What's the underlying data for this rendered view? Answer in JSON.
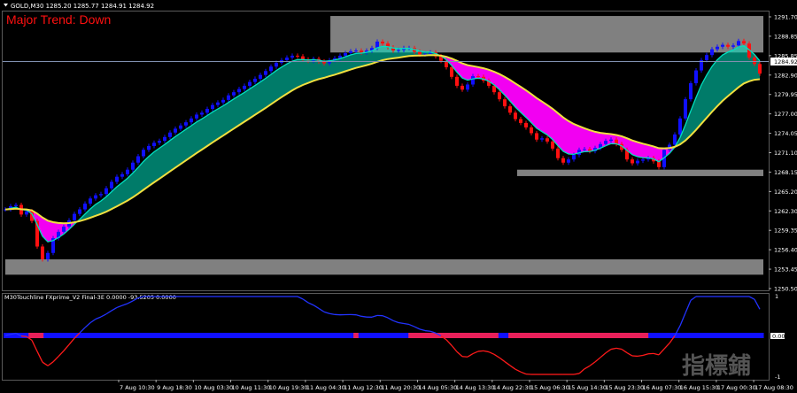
{
  "header": {
    "symbol_info": "GOLD,M30  1285.20 1285.77 1284.91 1284.92",
    "trend_label": "Major Trend: Down"
  },
  "indicator": {
    "label": "M30Touchline  FXprime_V2 Final-3E 0.0000 -93.5205 0.0000",
    "scale_top": "1",
    "scale_mid": "0.00",
    "scale_bottom": "-1"
  },
  "watermark": "指標鋪",
  "colors": {
    "background": "#000000",
    "bull_candle": "#1010ff",
    "bear_candle": "#ff1010",
    "fast_band": "#00e0c0",
    "ribbon_down": "#ff00ff",
    "slow_ma": "#f0e040",
    "zone_box": "#808080",
    "osc_line_up": "#2233ff",
    "osc_line_down": "#ff1a1a",
    "grid": "#5a5a5a"
  },
  "price_axis": {
    "current_price": "1284.92",
    "ticks": [
      "1291.70",
      "1288.85",
      "1285.85",
      "1282.90",
      "1279.95",
      "1277.00",
      "1274.05",
      "1271.10",
      "1268.15",
      "1265.20",
      "1262.30",
      "1259.35",
      "1256.40",
      "1253.45",
      "1250.50"
    ]
  },
  "time_axis": {
    "ticks": [
      "7 Aug 10:30",
      "9 Aug 18:30",
      "10 Aug 03:30",
      "10 Aug 11:30",
      "10 Aug 19:30",
      "11 Aug 04:30",
      "11 Aug 12:30",
      "11 Aug 20:30",
      "14 Aug 05:30",
      "14 Aug 13:30",
      "14 Aug 22:30",
      "15 Aug 06:30",
      "15 Aug 14:30",
      "15 Aug 23:30",
      "16 Aug 07:30",
      "16 Aug 15:30",
      "17 Aug 00:30",
      "17 Aug 08:30"
    ]
  },
  "chart_data": {
    "type": "candlestick",
    "symbol": "GOLD",
    "timeframe": "M30",
    "price_range": [
      1249.8,
      1293.2
    ],
    "close": [
      1262.3,
      1262.8,
      1263.0,
      1261.5,
      1262.0,
      1260.5,
      1256.5,
      1254.5,
      1255.5,
      1257.8,
      1258.8,
      1259.6,
      1260.6,
      1261.6,
      1262.3,
      1263.2,
      1264.0,
      1264.5,
      1264.7,
      1265.6,
      1266.6,
      1267.4,
      1267.8,
      1268.5,
      1269.6,
      1270.6,
      1271.6,
      1272.2,
      1272.7,
      1273.0,
      1273.6,
      1274.3,
      1274.9,
      1275.4,
      1275.9,
      1276.5,
      1277.1,
      1277.4,
      1278.0,
      1278.6,
      1279.0,
      1279.4,
      1280.1,
      1280.6,
      1281.1,
      1281.6,
      1282.2,
      1282.7,
      1283.3,
      1283.9,
      1284.6,
      1285.2,
      1285.6,
      1286.0,
      1286.3,
      1286.2,
      1285.7,
      1285.5,
      1285.8,
      1285.4,
      1285.1,
      1285.6,
      1285.9,
      1286.3,
      1286.7,
      1287.0,
      1287.1,
      1286.8,
      1287.1,
      1287.5,
      1288.5,
      1288.2,
      1287.6,
      1287.1,
      1287.2,
      1287.5,
      1287.5,
      1286.9,
      1286.5,
      1286.6,
      1286.8,
      1286.2,
      1285.5,
      1284.5,
      1283.0,
      1281.6,
      1281.0,
      1281.8,
      1283.1,
      1283.0,
      1282.4,
      1281.6,
      1280.6,
      1279.5,
      1278.4,
      1277.4,
      1276.4,
      1275.8,
      1275.1,
      1274.2,
      1273.2,
      1273.4,
      1272.9,
      1271.8,
      1270.3,
      1269.6,
      1270.1,
      1270.8,
      1271.6,
      1271.7,
      1271.4,
      1271.9,
      1272.5,
      1273.0,
      1273.2,
      1272.5,
      1271.6,
      1270.1,
      1269.5,
      1269.9,
      1270.1,
      1270.3,
      1269.8,
      1268.9,
      1271.6,
      1272.4,
      1274.0,
      1276.5,
      1279.5,
      1282.0,
      1284.0,
      1285.6,
      1286.4,
      1287.3,
      1287.7,
      1288.0,
      1287.7,
      1287.9,
      1288.6,
      1288.2,
      1286.0,
      1285.0,
      1283.5
    ],
    "zones": [
      {
        "from": 1286.8,
        "to": 1292.5,
        "start": "11 Aug 12:30",
        "end": "17 Aug 08:30"
      },
      {
        "from": 1252.1,
        "to": 1254.5,
        "start": "7 Aug 10:30",
        "end": "17 Aug 08:30"
      },
      {
        "from": 1267.5,
        "to": 1268.5,
        "start": "15 Aug 06:30",
        "end": "17 Aug 08:30"
      }
    ],
    "slow_ma_type": "line",
    "oscillator": {
      "name": "M30Touchline FXprime_V2 Final-3E",
      "values_shown": [
        0.0,
        -93.5205,
        0.0
      ],
      "range": [
        -1,
        1
      ],
      "histogram": [
        "blue",
        "blue",
        "blue",
        "blue",
        "blue",
        "red",
        "red",
        "red",
        "blue",
        "blue",
        "blue",
        "blue",
        "blue",
        "blue",
        "blue",
        "blue",
        "blue",
        "blue",
        "blue",
        "blue",
        "blue",
        "blue",
        "blue",
        "blue",
        "blue",
        "blue",
        "blue",
        "blue",
        "blue",
        "blue",
        "blue",
        "blue",
        "blue",
        "blue",
        "blue",
        "blue",
        "blue",
        "blue",
        "blue",
        "blue",
        "blue",
        "blue",
        "blue",
        "blue",
        "blue",
        "blue",
        "blue",
        "blue",
        "blue",
        "blue",
        "blue",
        "blue",
        "blue",
        "blue",
        "blue",
        "blue",
        "blue",
        "blue",
        "blue",
        "blue",
        "blue",
        "blue",
        "blue",
        "blue",
        "blue",
        "blue",
        "blue",
        "blue",
        "blue",
        "blue",
        "red",
        "blue",
        "blue",
        "blue",
        "blue",
        "blue",
        "blue",
        "blue",
        "blue",
        "blue",
        "blue",
        "red",
        "red",
        "red",
        "red",
        "red",
        "red",
        "red",
        "red",
        "red",
        "red",
        "red",
        "red",
        "red",
        "red",
        "red",
        "red",
        "red",
        "red",
        "blue",
        "blue",
        "red",
        "red",
        "red",
        "red",
        "red",
        "red",
        "red",
        "red",
        "red",
        "red",
        "red",
        "red",
        "red",
        "red",
        "red",
        "red",
        "red",
        "red",
        "red",
        "red",
        "red",
        "red",
        "red",
        "red",
        "red",
        "red",
        "red",
        "red",
        "blue",
        "blue",
        "blue",
        "blue",
        "blue",
        "blue",
        "blue",
        "blue",
        "blue",
        "blue",
        "blue",
        "blue",
        "blue",
        "blue",
        "blue",
        "blue",
        "blue",
        "blue",
        "blue",
        "blue",
        "blue",
        "blue",
        "blue"
      ]
    }
  }
}
